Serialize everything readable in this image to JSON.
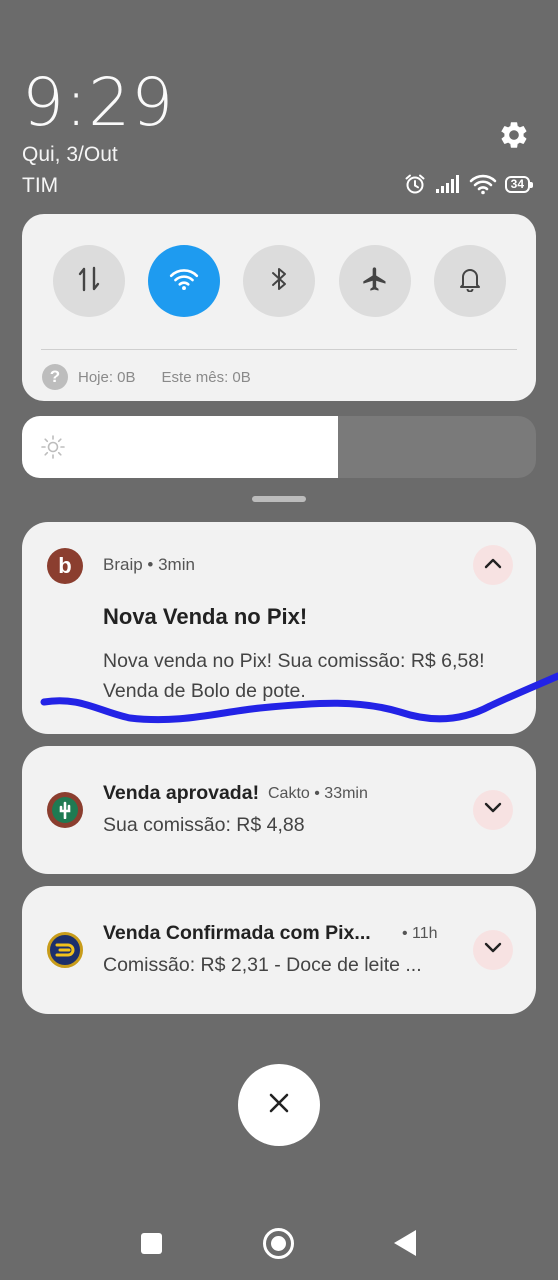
{
  "status": {
    "time": "9:29",
    "date": "Qui, 3/Out",
    "carrier": "TIM",
    "battery": "34"
  },
  "quick_settings": {
    "tiles": [
      {
        "name": "mobile-data",
        "icon": "data-transfer-arrows-icon",
        "active": false
      },
      {
        "name": "wifi",
        "icon": "wifi-icon",
        "active": true
      },
      {
        "name": "bluetooth",
        "icon": "bluetooth-icon",
        "active": false
      },
      {
        "name": "airplane-mode",
        "icon": "airplane-icon",
        "active": false
      },
      {
        "name": "notifications-sound",
        "icon": "bell-icon",
        "active": false
      }
    ],
    "usage_today": "Hoje: 0B",
    "usage_month": "Este mês: 0B"
  },
  "brightness": {
    "level": 0.615
  },
  "notifications": [
    {
      "app": "Braip",
      "time": "3min",
      "title": "Nova Venda no Pix!",
      "body": "Nova venda no Pix! Sua comissão: R$ 6,58! Venda de Bolo de pote.",
      "expanded": true
    },
    {
      "app": "Cakto",
      "time": "33min",
      "title": "Venda aprovada!",
      "body": "Sua comissão: R$ 4,88",
      "expanded": false
    },
    {
      "app": "",
      "time": "11h",
      "title": "Venda Confirmada com Pix...",
      "body": "Comissão: R$ 2,31 - Doce de leite ...",
      "expanded": false
    }
  ],
  "colors": {
    "background": "#6b6b6b",
    "wifi_active": "#1e9bf0",
    "annotation_stroke": "#2323e6"
  }
}
